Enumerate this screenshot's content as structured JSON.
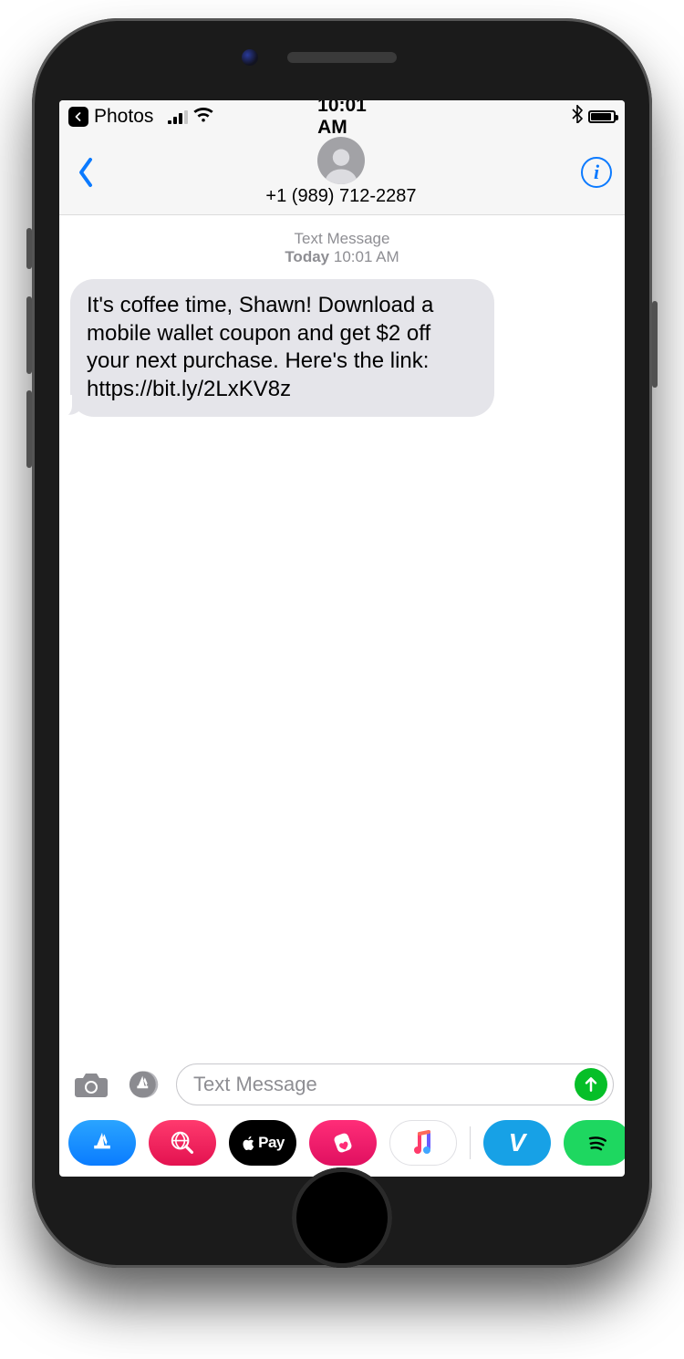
{
  "statusbar": {
    "back_app": "Photos",
    "time": "10:01 AM"
  },
  "header": {
    "phone_number": "+1 (989) 712-2287"
  },
  "thread": {
    "type_label": "Text Message",
    "day_label": "Today",
    "timestamp": "10:01 AM",
    "message_text": "It's coffee time, Shawn! Download a mobile wallet coupon and get $2 off your next purchase. Here's the link: https://bit.ly/2LxKV8z"
  },
  "compose": {
    "placeholder": "Text Message"
  },
  "drawer": {
    "venmo_label": "V",
    "applepay_label": "Pay"
  }
}
